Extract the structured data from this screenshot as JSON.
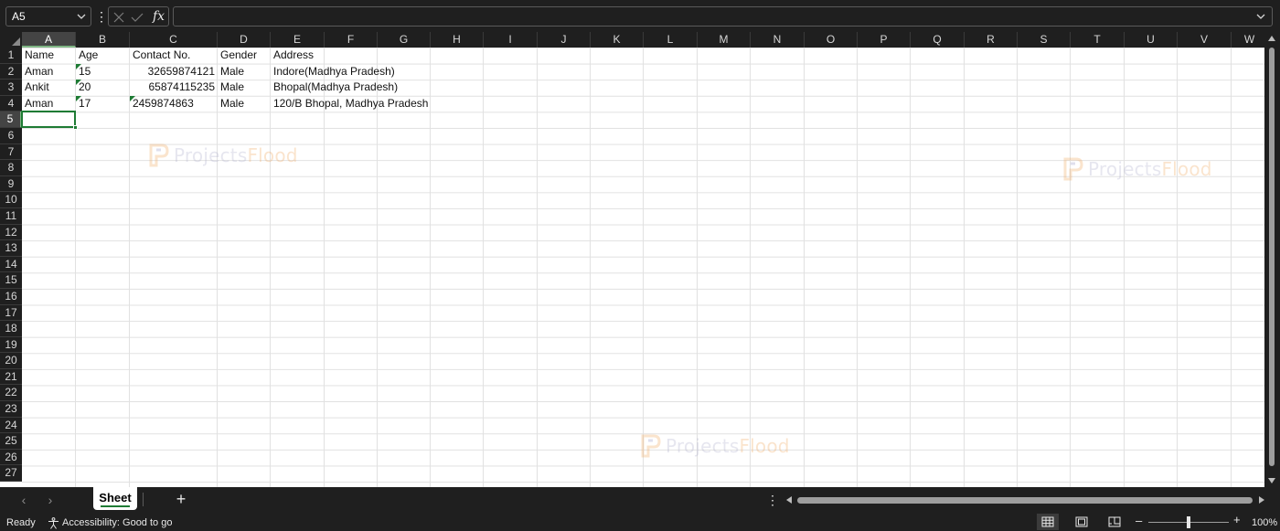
{
  "formula_bar": {
    "name_box": "A5",
    "fx": "fx",
    "formula_value": "",
    "more": "⋮"
  },
  "grid": {
    "columns": [
      "A",
      "B",
      "C",
      "D",
      "E",
      "F",
      "G",
      "H",
      "I",
      "J",
      "K",
      "L",
      "M",
      "N",
      "O",
      "P",
      "Q",
      "R",
      "S",
      "T",
      "U",
      "V",
      "W"
    ],
    "rows": [
      "1",
      "2",
      "3",
      "4",
      "5",
      "6",
      "7",
      "8",
      "9",
      "10",
      "11",
      "12",
      "13",
      "14",
      "15",
      "16",
      "17",
      "18",
      "19",
      "20",
      "21",
      "22",
      "23",
      "24",
      "25",
      "26",
      "27"
    ],
    "selected_cell": "A5",
    "headers": [
      "Name",
      "Age",
      "Contact No.",
      "Gender",
      "Address"
    ],
    "data": [
      {
        "name": "Aman",
        "age": "15",
        "contact": "32659874121",
        "gender": "Male",
        "address": "Indore(Madhya Pradesh)"
      },
      {
        "name": "Ankit",
        "age": "20",
        "contact": "65874115235",
        "gender": "Male",
        "address": "Bhopal(Madhya Pradesh)"
      },
      {
        "name": "Aman",
        "age": "17",
        "contact": "2459874863",
        "gender": "Male",
        "address": "120/B Bhopal, Madhya Pradesh"
      }
    ]
  },
  "watermarks": [
    {
      "part1": "Projects",
      "part2": "Flood"
    },
    {
      "part1": "Projects",
      "part2": "Flood"
    },
    {
      "part1": "Projects",
      "part2": "Flood"
    }
  ],
  "sheet_tabs": {
    "tabs": [
      "Sheet"
    ],
    "add": "+",
    "prev": "‹",
    "next": "›",
    "more": "⋮"
  },
  "status_bar": {
    "ready": "Ready",
    "accessibility": "Accessibility: Good to go",
    "zoom_minus": "–",
    "zoom_plus": "+",
    "zoom_level": "100%"
  },
  "colors": {
    "accent_green": "#1e7b34",
    "chrome_dark": "#1f1f1f"
  }
}
